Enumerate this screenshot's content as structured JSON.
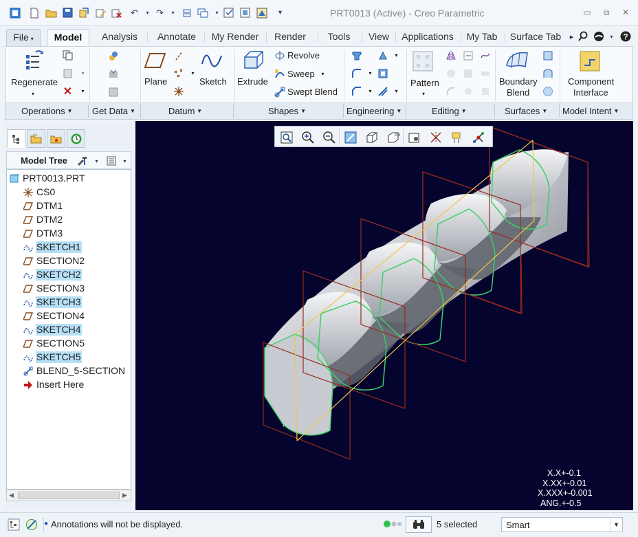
{
  "window": {
    "title": "PRT0013 (Active) - Creo Parametric",
    "controls": {
      "minimize": "▭",
      "restore": "⧉",
      "close": "✕"
    }
  },
  "tabs": [
    {
      "label": "File",
      "caret": "▾"
    },
    {
      "label": "Model"
    },
    {
      "label": "Analysis"
    },
    {
      "label": "Annotate"
    },
    {
      "label": "My Render"
    },
    {
      "label": "Render"
    },
    {
      "label": "Tools"
    },
    {
      "label": "View"
    },
    {
      "label": "Applications"
    },
    {
      "label": "My Tab"
    },
    {
      "label": "Surface Tab"
    }
  ],
  "ribbon": {
    "regenerate": "Regenerate",
    "plane": "Plane",
    "sketch": "Sketch",
    "extrude": "Extrude",
    "revolve": "Revolve",
    "sweep": "Sweep",
    "swept_blend": "Swept Blend",
    "pattern": "Pattern",
    "boundary_blend_1": "Boundary",
    "boundary_blend_2": "Blend",
    "component_interface_1": "Component",
    "component_interface_2": "Interface"
  },
  "groups": [
    {
      "label": "Operations"
    },
    {
      "label": "Get Data"
    },
    {
      "label": "Datum"
    },
    {
      "label": "Shapes"
    },
    {
      "label": "Engineering"
    },
    {
      "label": "Editing"
    },
    {
      "label": "Surfaces"
    },
    {
      "label": "Model Intent"
    }
  ],
  "model_tree": {
    "title": "Model Tree",
    "items": [
      {
        "label": "PRT0013.PRT",
        "icon": "part-icon",
        "selected": false
      },
      {
        "label": "CS0",
        "icon": "csys-icon",
        "selected": false
      },
      {
        "label": "DTM1",
        "icon": "datum-plane-icon",
        "selected": false
      },
      {
        "label": "DTM2",
        "icon": "datum-plane-icon",
        "selected": false
      },
      {
        "label": "DTM3",
        "icon": "datum-plane-icon",
        "selected": false
      },
      {
        "label": "SKETCH1",
        "icon": "sketch-icon",
        "selected": true
      },
      {
        "label": "SECTION2",
        "icon": "datum-plane-icon",
        "selected": false
      },
      {
        "label": "SKETCH2",
        "icon": "sketch-icon",
        "selected": true
      },
      {
        "label": "SECTION3",
        "icon": "datum-plane-icon",
        "selected": false
      },
      {
        "label": "SKETCH3",
        "icon": "sketch-icon",
        "selected": true
      },
      {
        "label": "SECTION4",
        "icon": "datum-plane-icon",
        "selected": false
      },
      {
        "label": "SKETCH4",
        "icon": "sketch-icon",
        "selected": true
      },
      {
        "label": "SECTION5",
        "icon": "datum-plane-icon",
        "selected": false
      },
      {
        "label": "SKETCH5",
        "icon": "sketch-icon",
        "selected": true
      },
      {
        "label": "BLEND_5-SECTION",
        "icon": "blend-icon",
        "selected": false
      },
      {
        "label": "Insert Here",
        "icon": "insert-here-arrow-icon",
        "selected": false
      }
    ]
  },
  "tolerance": {
    "l1": "X.X+-0.1",
    "l2": "X.XX+-0.01",
    "l3": "X.XXX+-0.001",
    "l4": "ANG.+-0.5"
  },
  "status": {
    "message": "Annotations will not be displayed.",
    "selected": "5 selected",
    "filter": "Smart"
  },
  "colors": {
    "viewport_bg": "#04042e",
    "selection_highlight": "#b7e0f7",
    "datum_plane": "#9a2a1e",
    "section_edge": "#3ecf6a",
    "trajectory": "#f2c64b"
  }
}
